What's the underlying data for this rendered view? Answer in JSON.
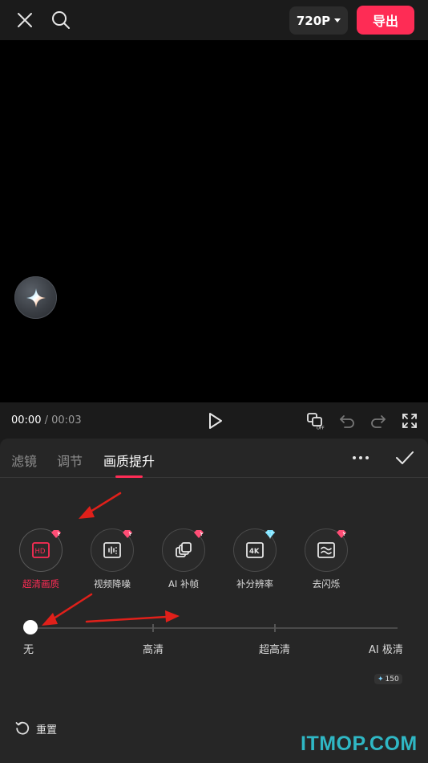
{
  "header": {
    "resolution_label": "720P",
    "export_label": "导出"
  },
  "playback": {
    "current_time": "00:00",
    "separator": " / ",
    "total_time": "00:03"
  },
  "tabs": [
    {
      "label": "滤镜",
      "active": false
    },
    {
      "label": "调节",
      "active": false
    },
    {
      "label": "画质提升",
      "active": true
    }
  ],
  "features": [
    {
      "label": "超清画质",
      "icon": "hd-icon",
      "badge": "pink-gem",
      "active": true
    },
    {
      "label": "视频降噪",
      "icon": "denoise-icon",
      "badge": "pink-gem",
      "active": false
    },
    {
      "label": "AI 补帧",
      "icon": "frame-interpolation-icon",
      "badge": "pink-gem",
      "active": false
    },
    {
      "label": "补分辨率",
      "icon": "4k-icon",
      "badge": "blue-gem",
      "active": false
    },
    {
      "label": "去闪烁",
      "icon": "deflicker-icon",
      "badge": "pink-gem",
      "active": false
    }
  ],
  "quality_slider": {
    "levels": [
      "无",
      "高清",
      "超高清",
      "AI 极清"
    ],
    "selected_index": 0,
    "ai_credit": "150"
  },
  "reset_label": "重置",
  "watermark": "ITMOP.COM",
  "colors": {
    "accent": "#fe2c55",
    "panel": "#262626",
    "preview": "#000000",
    "watermark": "#2fb7c4",
    "annotation_arrow": "#e0201a"
  }
}
